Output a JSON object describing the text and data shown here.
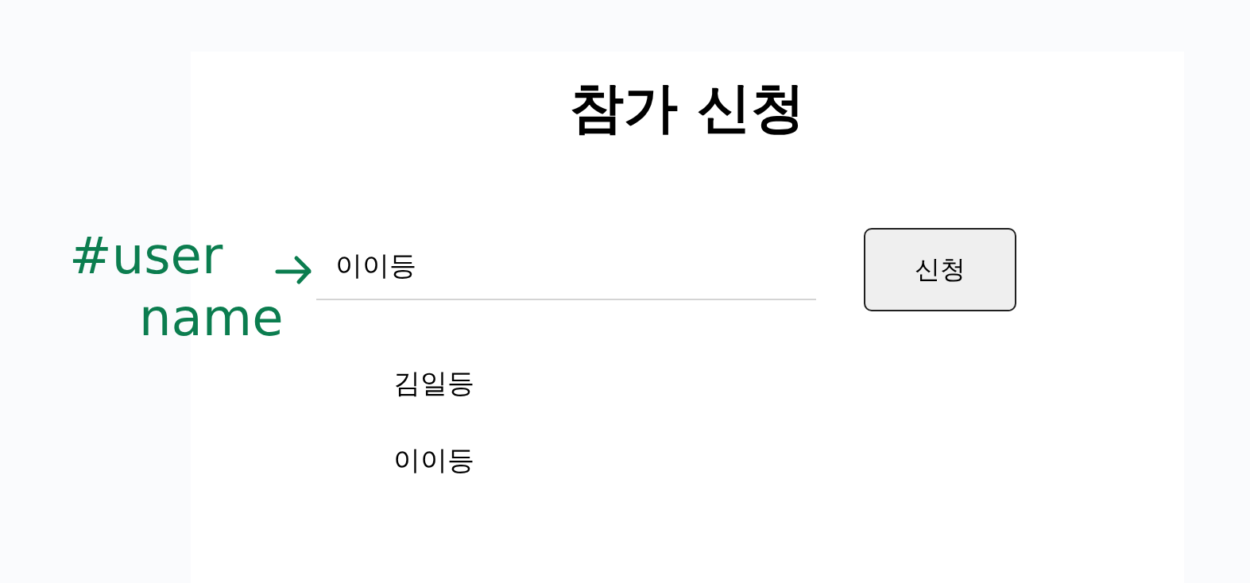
{
  "annotation": {
    "lines": [
      "#user",
      "name"
    ]
  },
  "title": "참가 신청",
  "name_field": {
    "value": "이이등"
  },
  "submit_button": {
    "label": "신청"
  },
  "participants": [
    "김일등",
    "이이등"
  ]
}
